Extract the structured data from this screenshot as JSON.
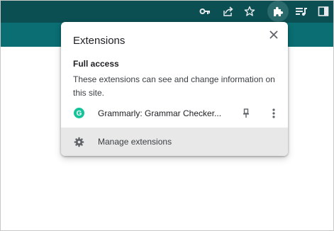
{
  "colors": {
    "toolbar": "#0b4f52",
    "band": "#0a6e72",
    "grammarly": "#15c39a",
    "manage_row_bg": "#e8e8e8"
  },
  "toolbar": {
    "icons": [
      "key-icon",
      "share-icon",
      "star-icon",
      "extensions-puzzle-icon",
      "reading-list-icon",
      "side-panel-icon"
    ],
    "active_icon": "extensions-puzzle-icon"
  },
  "popup": {
    "title": "Extensions",
    "close_icon": "close-icon",
    "full_access": {
      "title": "Full access",
      "description": "These extensions can see and change information on this site."
    },
    "extensions": [
      {
        "name": "Grammarly: Grammar Checker...",
        "logo_letter": "G",
        "icon": "grammarly-icon"
      }
    ],
    "manage": {
      "label": "Manage extensions",
      "icon": "gear-icon"
    }
  }
}
